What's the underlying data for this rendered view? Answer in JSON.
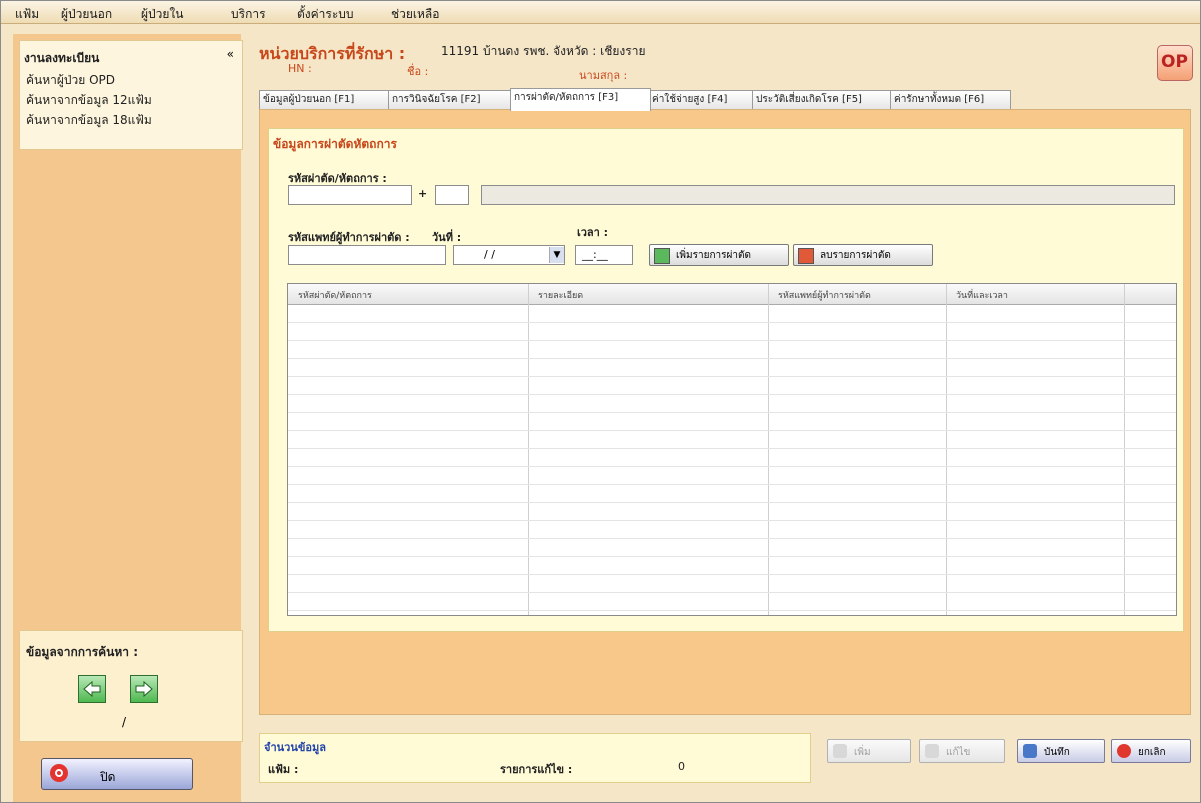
{
  "menu": [
    "แฟ้ม",
    "ผู้ป่วยนอก",
    "ผู้ป่วยใน",
    "บริการ",
    "ตั้งค่าระบบ",
    "ช่วยเหลือ"
  ],
  "sidebar": {
    "heading": "งานลงทะเบียน",
    "collapse_glyph": "«",
    "items": [
      "ค้นหาผู้ป่วย OPD",
      "ค้นหาจากข้อมูล 12แฟ้ม",
      "ค้นหาจากข้อมูล 18แฟ้ม"
    ],
    "nav_title": "ข้อมูลจากการค้นหา :",
    "nav_position": "/",
    "close_label": "ปิด"
  },
  "header": {
    "unit_label": "หน่วยบริการที่รักษา :",
    "unit_value": "11191 บ้านดง รพช. จังหวัด : เชียงราย",
    "hn_label": "HN :",
    "name_label": "ชื่อ :",
    "right_label": "นามสกุล :",
    "badge": "OP"
  },
  "tabs": [
    {
      "label": "ข้อมูลผู้ป่วยนอก [F1]",
      "active": false
    },
    {
      "label": "การวินิจฉัยโรค [F2]",
      "active": false
    },
    {
      "label": "การผ่าตัด/หัตถการ [F3]",
      "active": true
    },
    {
      "label": "ค่าใช้จ่ายสูง [F4]",
      "active": false
    },
    {
      "label": "ประวัติเสี่ยงเกิดโรค [F5]",
      "active": false
    },
    {
      "label": "ค่ารักษาทั้งหมด [F6]",
      "active": false
    }
  ],
  "form": {
    "section_title": "ข้อมูลการผ่าตัดหัตถการ",
    "procedure_code_label": "รหัสผ่าตัด/หัตถการ :",
    "separator": "+",
    "doctor_label": "รหัสแพทย์ผู้ทำการผ่าตัด :",
    "date_label": "วันที่ :",
    "date_value": "/ /",
    "time_label": "เวลา :",
    "time_value": "__:__",
    "add_button": "เพิ่มรายการผ่าตัด",
    "delete_button": "ลบรายการผ่าตัด"
  },
  "grid": {
    "columns": [
      "รหัสผ่าตัด/หัตถการ",
      "รายละเอียด",
      "รหัสแพทย์ผู้ทำการผ่าตัด",
      "วันที่และเวลา"
    ],
    "rows": []
  },
  "summary": {
    "title": "จำนวนข้อมูล",
    "rows_label": "แฟ้ม :",
    "records_label": "รายการแก้ไข :",
    "records_value": "0"
  },
  "actions": [
    {
      "label": "เพิ่ม",
      "enabled": false,
      "icon": "add-icon"
    },
    {
      "label": "แก้ไข",
      "enabled": false,
      "icon": "edit-icon"
    },
    {
      "label": "บันทึก",
      "enabled": true,
      "icon": "save-icon"
    },
    {
      "label": "ยกเลิก",
      "enabled": true,
      "icon": "cancel-icon"
    }
  ]
}
